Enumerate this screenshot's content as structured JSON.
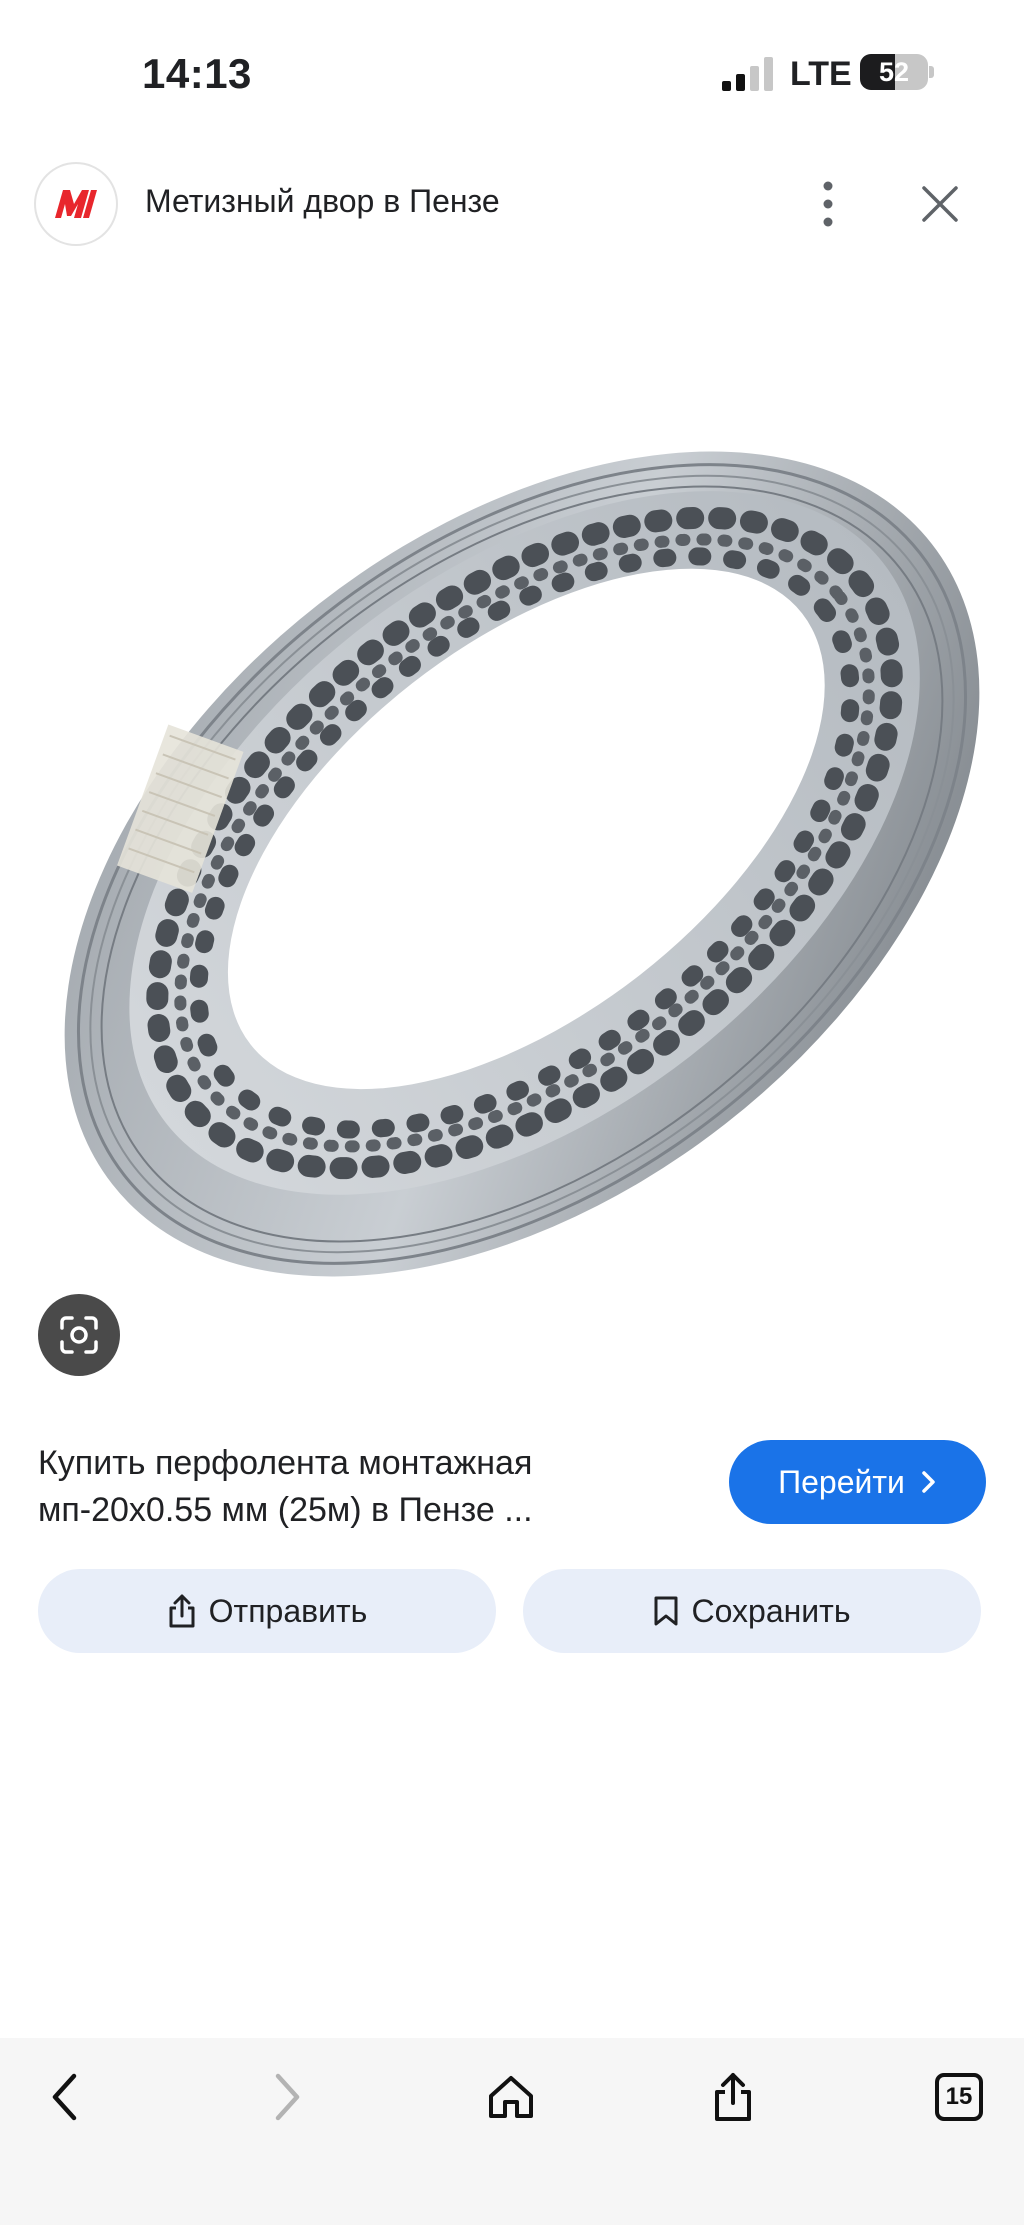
{
  "status_bar": {
    "time": "14:13",
    "network": "LTE",
    "battery_percent": "52",
    "battery_level": 0.52,
    "signal_bars_active": 2,
    "signal_bars_total": 4
  },
  "header": {
    "site_name": "Метизный двор в Пензе",
    "favicon_icon": "metiz-logo-icon",
    "more_icon": "more-vertical-icon",
    "close_icon": "close-icon"
  },
  "image": {
    "lens_icon": "google-lens-icon"
  },
  "result": {
    "title": "Купить перфолента монтажная мп-20х0.55 мм (25м) в Пензе ...",
    "goto_label": "Перейти",
    "share_label": "Отправить",
    "save_label": "Сохранить"
  },
  "toolbar": {
    "tabs_count": "15"
  },
  "colors": {
    "accent": "#1a73e8",
    "action_bg": "#e8eef9",
    "logo_red": "#e8262c"
  }
}
